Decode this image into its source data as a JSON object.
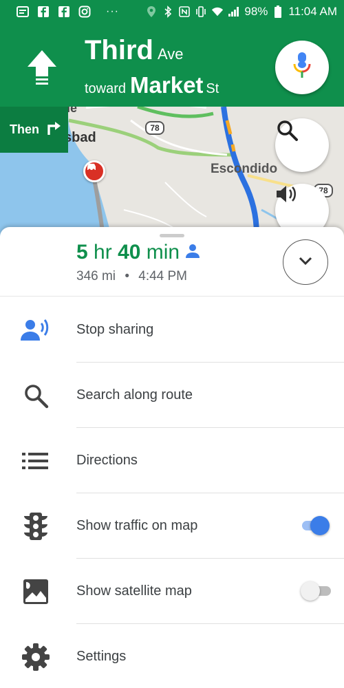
{
  "status_bar": {
    "battery": "98%",
    "time": "11:04 AM",
    "dots": "···"
  },
  "navigation": {
    "street_main": "Third",
    "street_suffix": "Ave",
    "toward_prefix": "toward",
    "toward_main": "Market",
    "toward_suffix": "St",
    "then_label": "Then"
  },
  "map": {
    "city_label": "Escondido",
    "partial_label": "sbad",
    "partial_top_label": "le",
    "highway_78a": "78",
    "highway_78b": "78"
  },
  "trip": {
    "duration_hours": "5",
    "duration_hr_unit": "hr",
    "duration_minutes": "40",
    "duration_min_unit": "min",
    "distance": "346 mi",
    "separator": "•",
    "arrival_time": "4:44 PM"
  },
  "menu": {
    "items": [
      {
        "label": "Stop sharing",
        "icon": "share-location-icon"
      },
      {
        "label": "Search along route",
        "icon": "search-icon"
      },
      {
        "label": "Directions",
        "icon": "list-icon"
      },
      {
        "label": "Show traffic on map",
        "icon": "traffic-light-icon",
        "toggle": "on"
      },
      {
        "label": "Show satellite map",
        "icon": "satellite-image-icon",
        "toggle": "off"
      },
      {
        "label": "Settings",
        "icon": "gear-icon"
      }
    ]
  },
  "colors": {
    "header_green": "#0f8f4c",
    "then_green": "#0c7d41",
    "toggle_blue": "#3b7de8"
  }
}
